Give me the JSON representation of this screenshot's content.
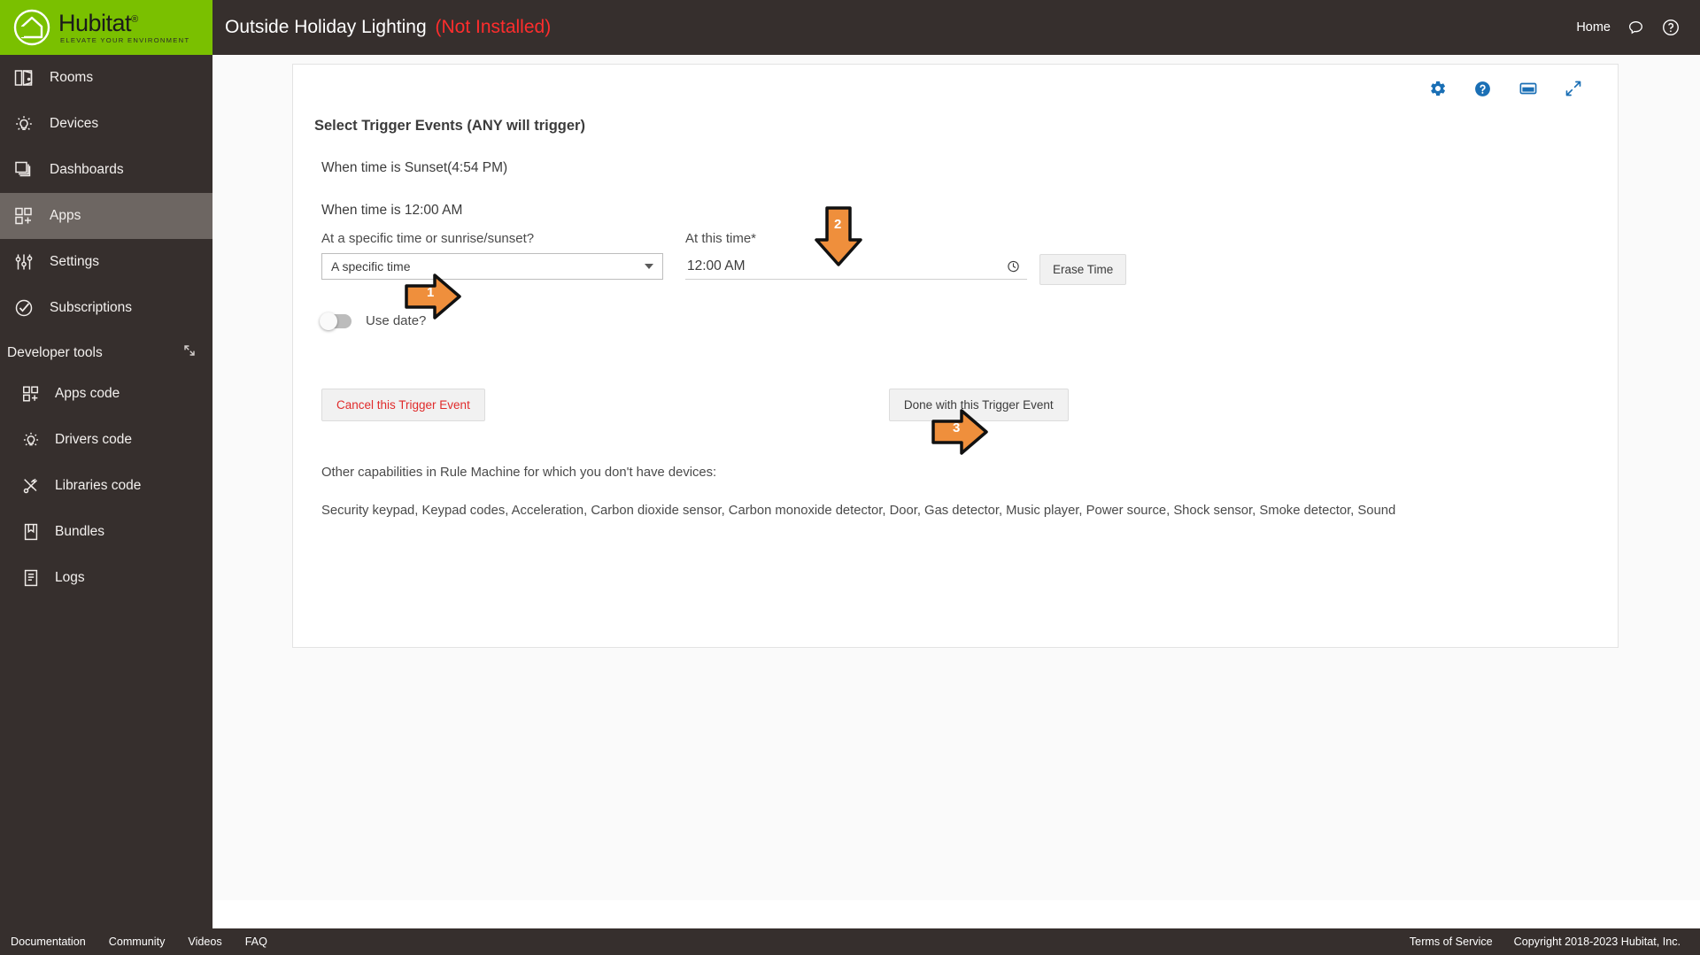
{
  "brand": {
    "name": "Hubitat",
    "trademark": "®",
    "tagline": "ELEVATE YOUR ENVIRONMENT",
    "logo_bg": "#7ac000"
  },
  "sidebar": {
    "items": [
      {
        "label": "Rooms",
        "icon": "rooms-icon",
        "active": false
      },
      {
        "label": "Devices",
        "icon": "devices-icon",
        "active": false
      },
      {
        "label": "Dashboards",
        "icon": "dashboards-icon",
        "active": false
      },
      {
        "label": "Apps",
        "icon": "apps-icon",
        "active": true
      },
      {
        "label": "Settings",
        "icon": "settings-icon",
        "active": false
      },
      {
        "label": "Subscriptions",
        "icon": "subscriptions-icon",
        "active": false
      }
    ],
    "developer_tools": {
      "label": "Developer tools",
      "collapse_icon": "collapse-icon",
      "items": [
        {
          "label": "Apps code",
          "icon": "apps-code-icon"
        },
        {
          "label": "Drivers code",
          "icon": "drivers-code-icon"
        },
        {
          "label": "Libraries code",
          "icon": "libraries-code-icon"
        },
        {
          "label": "Bundles",
          "icon": "bundles-icon"
        },
        {
          "label": "Logs",
          "icon": "logs-icon"
        }
      ]
    }
  },
  "topbar": {
    "title": "Outside Holiday Lighting",
    "status": "(Not Installed)",
    "status_color": "#ff2d2d",
    "home_label": "Home",
    "chat_icon": "chat-bubble-icon",
    "help_icon": "help-circle-icon"
  },
  "card": {
    "tools": [
      {
        "name": "gear-icon"
      },
      {
        "name": "help-icon"
      },
      {
        "name": "window-icon"
      },
      {
        "name": "expand-icon"
      }
    ],
    "accent_color": "#1a6fb5"
  },
  "main": {
    "section_title": "Select Trigger Events (ANY will trigger)",
    "trigger_events": [
      "When time is Sunset(4:54 PM)",
      "When time is 12:00 AM"
    ],
    "time_mode": {
      "label": "At a specific time or sunrise/sunset?",
      "value": "A specific time",
      "caret_icon": "chevron-down-icon"
    },
    "at_this_time": {
      "label": "At this time*",
      "value": "12:00 AM",
      "placeholder": "12:00 AM",
      "clock_icon": "clock-icon",
      "erase_button": "Erase Time"
    },
    "use_date": {
      "label": "Use date?",
      "state": "off"
    },
    "cancel_button": "Cancel this Trigger Event",
    "done_button": "Done with this Trigger Event",
    "capabilities_title": "Other capabilities in Rule Machine for which you don't have devices:",
    "capabilities_list": "Security keypad, Keypad codes, Acceleration, Carbon dioxide sensor, Carbon monoxide detector, Door, Gas detector, Music player, Power source, Shock sensor, Smoke detector, Sound"
  },
  "annotations": {
    "color": "#ef8f3c",
    "arrows": [
      {
        "number": "1",
        "direction": "right",
        "target": "time-mode-select"
      },
      {
        "number": "2",
        "direction": "down",
        "target": "at-this-time-input"
      },
      {
        "number": "3",
        "direction": "right",
        "target": "done-button"
      }
    ]
  },
  "footer": {
    "links": [
      "Documentation",
      "Community",
      "Videos",
      "FAQ"
    ],
    "terms": "Terms of Service",
    "copyright": "Copyright 2018-2023 Hubitat, Inc."
  }
}
